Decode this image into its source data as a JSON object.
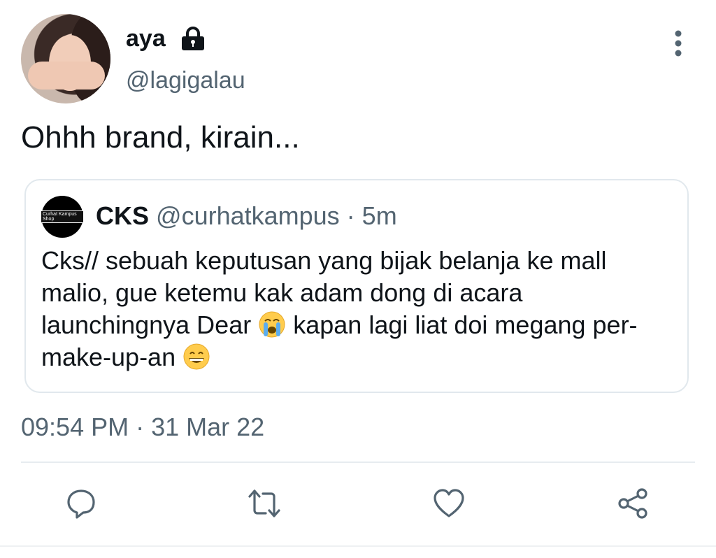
{
  "tweet": {
    "display_name": "aya",
    "handle": "@lagigalau",
    "text": "Ohhh brand, kirain...",
    "timestamp": "09:54 PM · 31 Mar 22"
  },
  "quote": {
    "avatar_text": "Curhat Kampus Shop",
    "display_name": "CKS",
    "handle_meta": "@curhatkampus · 5m",
    "text_part1": "Cks// sebuah keputusan yang bijak belanja ke mall malio, gue ketemu kak adam dong di acara launchingnya Dear",
    "text_part2": "kapan lagi liat doi megang per-make-up-an"
  },
  "icons": {
    "lock": "lock-icon",
    "more": "more-vertical-icon",
    "reply": "reply-icon",
    "retweet": "retweet-icon",
    "like": "heart-icon",
    "share": "share-icon",
    "emoji1": "loudly-crying-face-emoji",
    "emoji2": "grinning-face-emoji"
  },
  "colors": {
    "text": "#0f1419",
    "secondary": "#536471",
    "border": "#e1e8ed"
  }
}
